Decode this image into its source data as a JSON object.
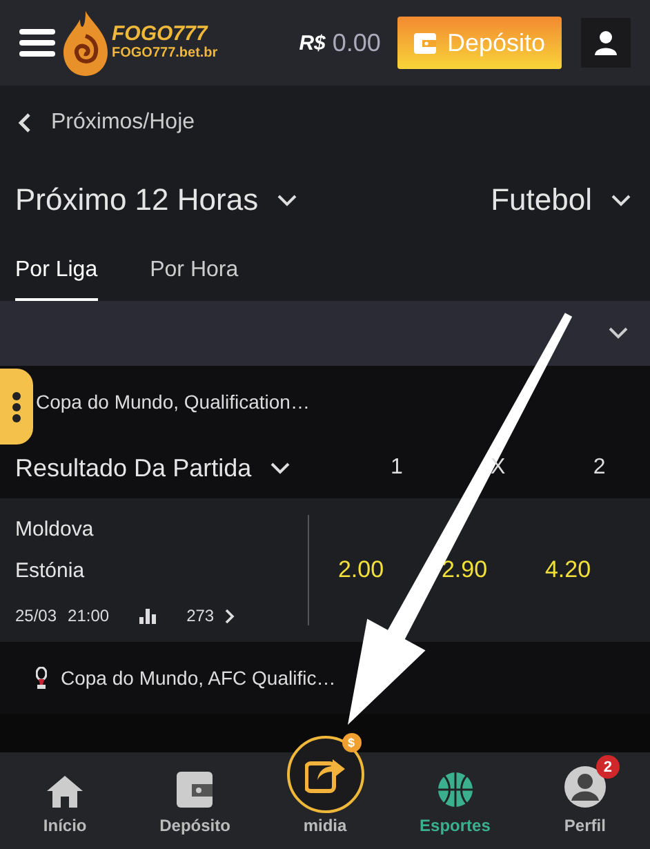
{
  "header": {
    "logo_title": "FOGO777",
    "logo_subtitle": "FOGO777.bet.br",
    "currency": "R$",
    "balance": "0.00",
    "deposit_button": "Depósito"
  },
  "breadcrumb": "Próximos/Hoje",
  "filters": {
    "period": "Próximo 12 Horas",
    "sport": "Futebol"
  },
  "tabs": [
    {
      "label": "Por Liga",
      "selected": true
    },
    {
      "label": "Por Hora",
      "selected": false
    }
  ],
  "leagues": [
    {
      "name": "Copa do Mundo, Qualification…",
      "market": "Resultado Da Partida",
      "columns": [
        "1",
        "X",
        "2"
      ],
      "matches": [
        {
          "home": "Moldova",
          "away": "Estónia",
          "date": "25/03",
          "time": "21:00",
          "markets": "273",
          "odds": [
            "2.00",
            "2.90",
            "4.20"
          ]
        }
      ]
    },
    {
      "name": "Copa do Mundo, AFC Qualific…"
    }
  ],
  "bottom_nav": [
    {
      "label": "Início",
      "kind": "home",
      "selected": false
    },
    {
      "label": "Depósito",
      "kind": "wallet",
      "selected": false
    },
    {
      "label": "midia",
      "kind": "share",
      "selected": false,
      "badge": "$"
    },
    {
      "label": "Esportes",
      "kind": "sports",
      "selected": true
    },
    {
      "label": "Perfil",
      "kind": "profile",
      "selected": false,
      "badge": "2"
    }
  ]
}
